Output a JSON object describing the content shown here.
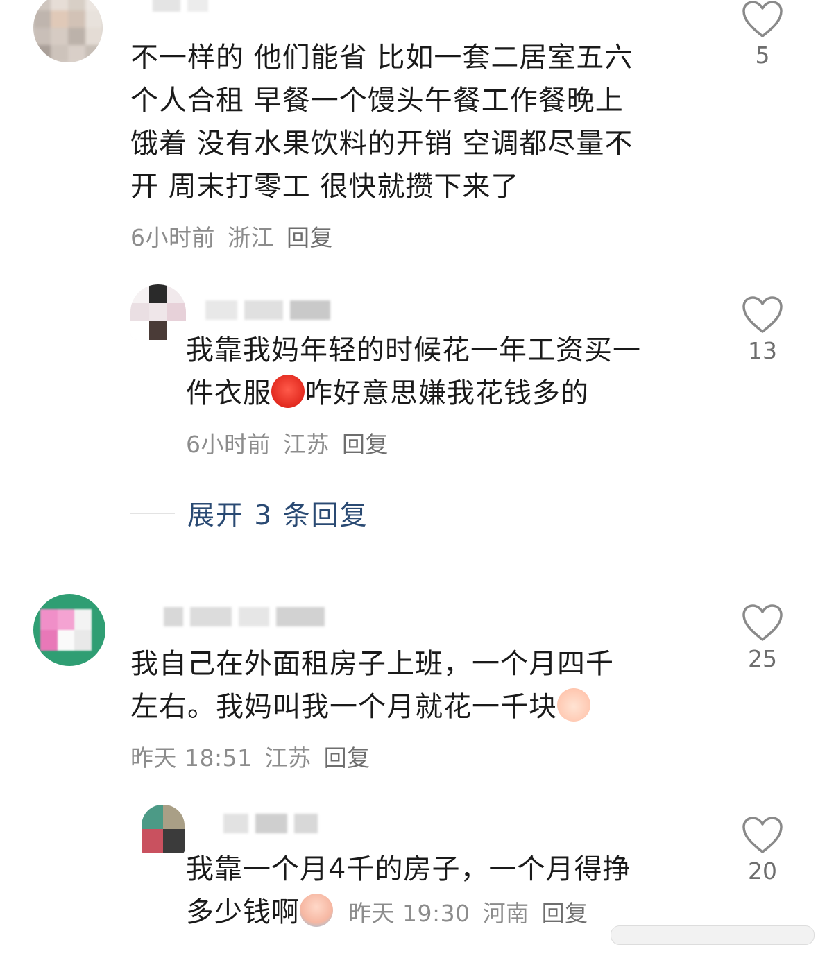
{
  "comments": [
    {
      "text": "不一样的 他们能省 比如一套二居室五六\n个人合租 早餐一个馒头午餐工作餐晚上\n饿着 没有水果饮料的开销 空调都尽量不\n开 周末打零工 很快就攒下来了",
      "time": "6小时前",
      "location": "浙江",
      "reply": "回复",
      "likes": "5"
    },
    {
      "text_before_emoji": "我靠我妈年轻的时候花一年工资买一\n件衣服",
      "emoji": "angry-face-emoji",
      "text_after_emoji": "咋好意思嫌我花钱多的",
      "time": "6小时前",
      "location": "江苏",
      "reply": "回复",
      "likes": "13"
    },
    {
      "expand_label": "展开 3 条回复"
    },
    {
      "text_before_emoji": "我自己在外面租房子上班，一个月四千\n左右。我妈叫我一个月就花一千块",
      "emoji": "smiling-peach-emoji",
      "time": "昨天 18:51",
      "location": "江苏",
      "reply": "回复",
      "likes": "25"
    },
    {
      "text_before_emoji": "我靠一个月4千的房子，一个月得挣\n多少钱啊",
      "emoji": "crying-face-emoji",
      "time": "昨天 19:30",
      "location": "河南",
      "reply": "回复",
      "likes": "20"
    }
  ],
  "colors": {
    "text": "#1a1a1a",
    "meta": "#8c8c8c",
    "link": "#2a4a73",
    "heart_outline": "#8a8a8a"
  }
}
